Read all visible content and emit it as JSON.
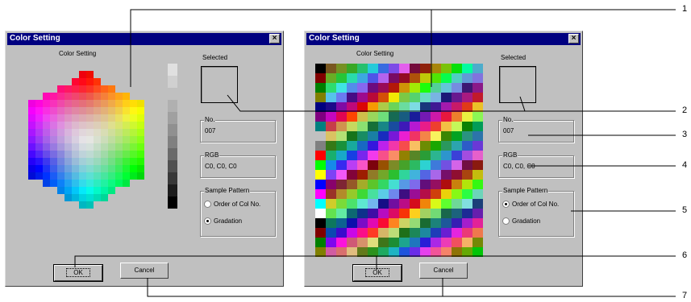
{
  "dialogs": [
    {
      "title": "Color Setting",
      "close_glyph": "×",
      "palette_label": "Color Setting",
      "selected_label": "Selected",
      "no_label": "No.",
      "no_value": "007",
      "rgb_label": "RGB",
      "rgb_value": "C0, C0, C0",
      "sample_label": "Sample Pattern",
      "options": [
        "Order of Col No.",
        "Gradation"
      ],
      "selected_option": "Gradation",
      "ok_label": "OK",
      "cancel_label": "Cancel"
    },
    {
      "title": "Color Setting",
      "close_glyph": "×",
      "palette_label": "Color Setting",
      "selected_label": "Selected",
      "no_label": "No.",
      "no_value": "007",
      "rgb_label": "RGB",
      "rgb_value": "C0, C0, C0",
      "sample_label": "Sample Pattern",
      "options": [
        "Order of Col No.",
        "Gradation"
      ],
      "selected_option": "Order of Col No.",
      "ok_label": "OK",
      "cancel_label": "Cancel"
    }
  ],
  "callouts": [
    "1",
    "2",
    "3",
    "4",
    "5",
    "6",
    "7"
  ],
  "colors": {
    "title_bar": "#000080",
    "dialog_bg": "#c0c0c0"
  },
  "gradation_column_colors": [
    "#e0e0e0",
    "#d0d0d0",
    "#c0c0c0",
    "#b0b0b0",
    "#a0a0a0",
    "#909090",
    "#808080",
    "#6a6a6a",
    "#505050",
    "#383838",
    "#1c1c1c",
    "#000000"
  ]
}
